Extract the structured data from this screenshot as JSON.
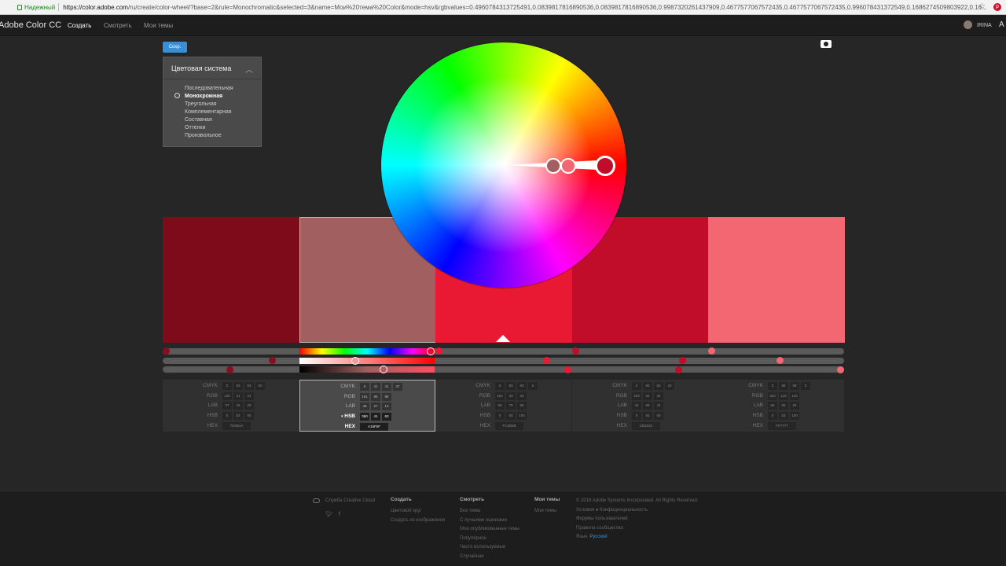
{
  "browser": {
    "secure_label": "Надежный",
    "url_host": "https://color.adobe.com",
    "url_path": "/ru/create/color-wheel/?base=2&rule=Monochromatic&selected=3&name=Мои%20тема%20Color&mode=hsv&rgbvalues=0.4960784313725491,0.0839817816890536,0.0839817816890536,0.9987320261437909,0.4677577067572435,0.4677577067572435,0.996078431372549,0.1686274509803922,0.16..."
  },
  "header": {
    "logo": "Adobe Color CC",
    "nav": [
      "Создать",
      "Смотреть",
      "Мои темы"
    ],
    "user": "IRINA"
  },
  "save_button": "Сохр.",
  "rule_panel": {
    "title": "Цветовая система",
    "options": [
      "Последовательная",
      "Монохромная",
      "Треугольная",
      "Комплементарная",
      "Составная",
      "Оттенки",
      "Произвольное"
    ],
    "selected": "Монохромная"
  },
  "accent_color": "#3b8ed4",
  "swatches": [
    {
      "hex": "7D0B1A",
      "cmyk": [
        "0",
        "83",
        "83",
        "50"
      ],
      "rgb": [
        "126",
        "21",
        "21"
      ],
      "lab": [
        "27",
        "43",
        "29"
      ],
      "hsb": [
        "0",
        "83",
        "50"
      ]
    },
    {
      "hex": "A15F5F",
      "cmyk": [
        "0",
        "41",
        "41",
        "37"
      ],
      "rgb": [
        "161",
        "95",
        "95"
      ],
      "lab": [
        "48",
        "27",
        "12"
      ],
      "hsb": [
        "360",
        "41",
        "63"
      ]
    },
    {
      "hex": "FC2B2B",
      "cmyk": [
        "0",
        "83",
        "83",
        "0"
      ],
      "rgb": [
        "254",
        "43",
        "43"
      ],
      "lab": [
        "56",
        "79",
        "55"
      ],
      "hsb": [
        "0",
        "83",
        "100"
      ]
    },
    {
      "hex": "CB2222",
      "cmyk": [
        "0",
        "83",
        "83",
        "20"
      ],
      "rgb": [
        "203",
        "34",
        "34"
      ],
      "lab": [
        "44",
        "69",
        "44"
      ],
      "hsb": [
        "0",
        "83",
        "80"
      ]
    },
    {
      "hex": "FF7777",
      "cmyk": [
        "0",
        "58",
        "58",
        "0"
      ],
      "rgb": [
        "254",
        "119",
        "119"
      ],
      "lab": [
        "66",
        "55",
        "25"
      ],
      "hsb": [
        "0",
        "53",
        "100"
      ]
    }
  ],
  "value_labels": [
    "CMYK",
    "RGB",
    "LAB",
    "HSB",
    "HEX"
  ],
  "active_swatch_index": 1,
  "footer": {
    "brand": "Служба Creative Cloud",
    "columns": [
      {
        "title": "Создать",
        "items": [
          "Цветовой круг",
          "Создать из изображения"
        ]
      },
      {
        "title": "Смотреть",
        "items": [
          "Все темы",
          "С лучшими оценками",
          "Мои опубликованные темы",
          "Популярное",
          "Часто используемые",
          "Случайная"
        ]
      },
      {
        "title": "Мои темы",
        "items": [
          "Мои темы"
        ]
      }
    ],
    "legal": {
      "copyright": "© 2016 Adobe Systems Incorporated. All Rights Reserved.",
      "terms": "Условия",
      "privacy": "Конфиденциальность",
      "forums": "Форумы пользователей",
      "guidelines": "Правила сообщества",
      "language_label": "Язык:",
      "language": "Русский"
    }
  }
}
